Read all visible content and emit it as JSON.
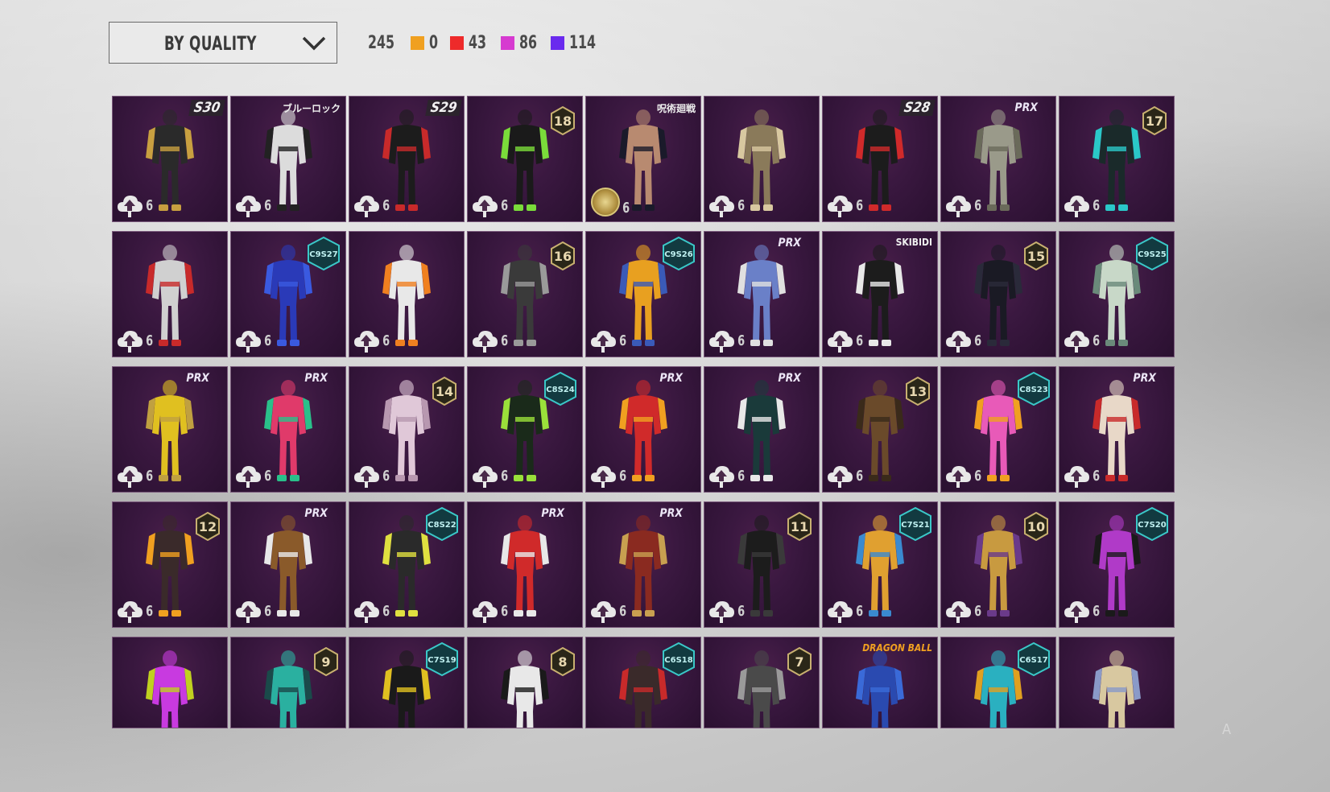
{
  "filter": {
    "label": "BY QUALITY",
    "total": "245"
  },
  "stats": [
    {
      "color": "#f0a020",
      "value": "0"
    },
    {
      "color": "#ee2a2a",
      "value": "43"
    },
    {
      "color": "#d63ad0",
      "value": "86"
    },
    {
      "color": "#6a2aee",
      "value": "114"
    }
  ],
  "upgrade_level": "6",
  "cards": [
    {
      "tag": "S30",
      "tagType": "season",
      "figure": "#2a2a2a",
      "accent": "#c8a040"
    },
    {
      "tag": "ブルーロック",
      "tagType": "text",
      "figure": "#dcdcdc",
      "accent": "#222"
    },
    {
      "tag": "S29",
      "tagType": "season",
      "figure": "#1c1c1c",
      "accent": "#c82a2a"
    },
    {
      "tag": "18",
      "tagType": "num",
      "figure": "#1a1a1a",
      "accent": "#7adc3a"
    },
    {
      "tag": "呪術廻戦",
      "tagType": "text",
      "figure": "#b88a70",
      "accent": "#1a1a2a",
      "coin": true
    },
    {
      "tag": "",
      "tagType": "none",
      "figure": "#8a7a5a",
      "accent": "#d8c8a0"
    },
    {
      "tag": "S28",
      "tagType": "season",
      "figure": "#1c1c1c",
      "accent": "#d02a2a"
    },
    {
      "tag": "PRX",
      "tagType": "prx",
      "figure": "#9a9a8a",
      "accent": "#6a6a5a"
    },
    {
      "tag": "17",
      "tagType": "num",
      "figure": "#1a2a2a",
      "accent": "#2ac8c8"
    },
    {
      "tag": "",
      "tagType": "none",
      "figure": "#d0d0d0",
      "accent": "#c82a2a"
    },
    {
      "tag": "C9S27",
      "tagType": "c",
      "figure": "#2a3ab8",
      "accent": "#3a5ae0"
    },
    {
      "tag": "",
      "tagType": "none",
      "figure": "#e8e8e8",
      "accent": "#f08020"
    },
    {
      "tag": "16",
      "tagType": "num",
      "figure": "#3a3a3a",
      "accent": "#9a9a9a"
    },
    {
      "tag": "C9S26",
      "tagType": "c",
      "figure": "#e8a020",
      "accent": "#3a5ab8"
    },
    {
      "tag": "PRX",
      "tagType": "prx",
      "figure": "#6a80c8",
      "accent": "#e0e0e0"
    },
    {
      "tag": "SKIBIDI",
      "tagType": "text",
      "figure": "#1c1c1c",
      "accent": "#e8e8e8"
    },
    {
      "tag": "15",
      "tagType": "num",
      "figure": "#1a1a24",
      "accent": "#2a2a3a"
    },
    {
      "tag": "C9S25",
      "tagType": "c",
      "figure": "#c8d8c8",
      "accent": "#6a8a7a"
    },
    {
      "tag": "PRX",
      "tagType": "prx",
      "figure": "#e0c020",
      "accent": "#c0a040"
    },
    {
      "tag": "PRX",
      "tagType": "prx",
      "figure": "#e03a6a",
      "accent": "#2ac08a"
    },
    {
      "tag": "14",
      "tagType": "num",
      "figure": "#e0c8d8",
      "accent": "#b898b0"
    },
    {
      "tag": "C8S24",
      "tagType": "c",
      "figure": "#1a2a1a",
      "accent": "#9ae03a"
    },
    {
      "tag": "PRX",
      "tagType": "prx",
      "figure": "#d02a2a",
      "accent": "#f0a020"
    },
    {
      "tag": "PRX",
      "tagType": "prx",
      "figure": "#1a3a3a",
      "accent": "#e8e8e8"
    },
    {
      "tag": "13",
      "tagType": "num",
      "figure": "#6a4a2a",
      "accent": "#3a2a1a"
    },
    {
      "tag": "C8S23",
      "tagType": "c",
      "figure": "#e85ab8",
      "accent": "#f0a020"
    },
    {
      "tag": "PRX",
      "tagType": "prx",
      "figure": "#e8d8c8",
      "accent": "#c82a2a"
    },
    {
      "tag": "12",
      "tagType": "num",
      "figure": "#3a2a2a",
      "accent": "#f0a020"
    },
    {
      "tag": "PRX",
      "tagType": "prx",
      "figure": "#8a5a2a",
      "accent": "#e8e8e8"
    },
    {
      "tag": "C8S22",
      "tagType": "c",
      "figure": "#2a2a2a",
      "accent": "#e0e040"
    },
    {
      "tag": "PRX",
      "tagType": "prx",
      "figure": "#d02a2a",
      "accent": "#e8e8e8"
    },
    {
      "tag": "PRX",
      "tagType": "prx",
      "figure": "#8a2a20",
      "accent": "#c8a050"
    },
    {
      "tag": "11",
      "tagType": "num",
      "figure": "#1c1c1c",
      "accent": "#3a3a3a"
    },
    {
      "tag": "C7S21",
      "tagType": "c",
      "figure": "#e0a030",
      "accent": "#3a8ad0"
    },
    {
      "tag": "10",
      "tagType": "num",
      "figure": "#c89a40",
      "accent": "#6a3a8a"
    },
    {
      "tag": "C7S20",
      "tagType": "c",
      "figure": "#b03ac8",
      "accent": "#1a1a1a"
    },
    {
      "tag": "",
      "tagType": "none",
      "figure": "#c83ae0",
      "accent": "#c0d020"
    },
    {
      "tag": "9",
      "tagType": "num",
      "figure": "#2ab0a0",
      "accent": "#1a4a4a"
    },
    {
      "tag": "C7S19",
      "tagType": "c",
      "figure": "#1a1a1a",
      "accent": "#e0c020"
    },
    {
      "tag": "8",
      "tagType": "num",
      "figure": "#e8e8e8",
      "accent": "#1a1a1a"
    },
    {
      "tag": "C6S18",
      "tagType": "c",
      "figure": "#3a2a2a",
      "accent": "#c82a2a"
    },
    {
      "tag": "7",
      "tagType": "num",
      "figure": "#4a4a4a",
      "accent": "#9a9a9a"
    },
    {
      "tag": "DRAGON BALL",
      "tagType": "dragon",
      "figure": "#2a4ab0",
      "accent": "#3a6ad8"
    },
    {
      "tag": "C6S17",
      "tagType": "c",
      "figure": "#2ab0c0",
      "accent": "#e0a020"
    },
    {
      "tag": "",
      "tagType": "none",
      "figure": "#d8c8a0",
      "accent": "#8a9ac8"
    }
  ]
}
